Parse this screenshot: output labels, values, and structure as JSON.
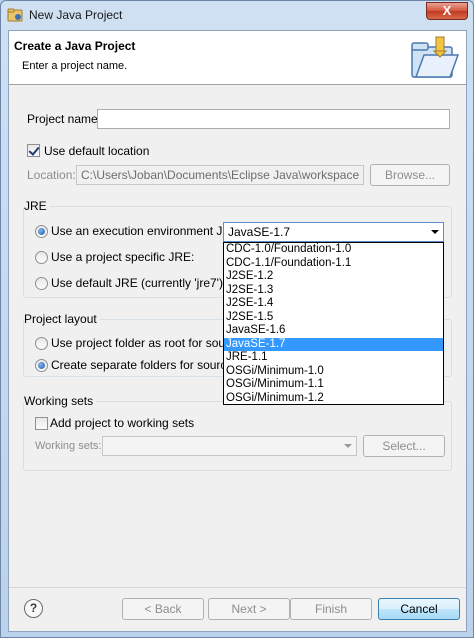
{
  "window": {
    "title": "New Java Project",
    "close_label": "X"
  },
  "banner": {
    "title": "Create a Java Project",
    "message": "Enter a project name."
  },
  "project": {
    "name_label": "Project name:",
    "name_value": ""
  },
  "location": {
    "use_default_label": "Use default location",
    "use_default_checked": true,
    "label": "Location:",
    "value": "C:\\Users\\Joban\\Documents\\Eclipse Java\\workspace",
    "browse_label": "Browse..."
  },
  "jre": {
    "group_title": "JRE",
    "exec_env_label": "Use an execution environment JRE:",
    "exec_env_value": "JavaSE-1.7",
    "project_specific_label": "Use a project specific JRE:",
    "default_label": "Use default JRE (currently 'jre7')",
    "options": [
      "CDC-1.0/Foundation-1.0",
      "CDC-1.1/Foundation-1.1",
      "J2SE-1.2",
      "J2SE-1.3",
      "J2SE-1.4",
      "J2SE-1.5",
      "JavaSE-1.6",
      "JavaSE-1.7",
      "JRE-1.1",
      "OSGi/Minimum-1.0",
      "OSGi/Minimum-1.1",
      "OSGi/Minimum-1.2"
    ]
  },
  "layout": {
    "group_title": "Project layout",
    "use_root_label": "Use project folder as root for sources",
    "separate_label": "Create separate folders for sources ar"
  },
  "working_sets": {
    "group_title": "Working sets",
    "add_label": "Add project to working sets",
    "sets_label": "Working sets:",
    "select_label": "Select..."
  },
  "footer": {
    "help_label": "?",
    "back_label": "< Back",
    "next_label": "Next >",
    "finish_label": "Finish",
    "cancel_label": "Cancel"
  }
}
